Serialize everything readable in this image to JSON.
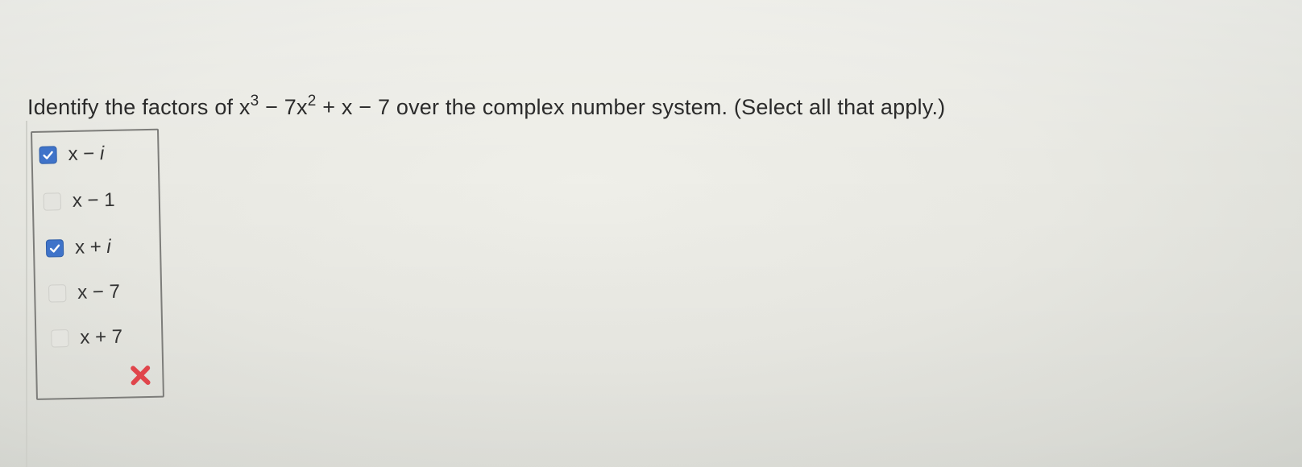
{
  "question": {
    "prefix": "Identify the factors of x",
    "exp1": "3",
    "mid1": " − 7x",
    "exp2": "2",
    "suffix": " + x − 7 over the complex number system. (Select all that apply.)"
  },
  "options": [
    {
      "label_pre": "x − ",
      "label_var": "i",
      "checked": true
    },
    {
      "label_pre": "x − 1",
      "label_var": "",
      "checked": false
    },
    {
      "label_pre": "x + ",
      "label_var": "i",
      "checked": true
    },
    {
      "label_pre": "x − 7",
      "label_var": "",
      "checked": false
    },
    {
      "label_pre": "x + 7",
      "label_var": "",
      "checked": false
    }
  ],
  "result": {
    "icon": "incorrect-x-icon",
    "color": "#e0454b"
  },
  "colors": {
    "checkbox_checked": "#3f73c9",
    "checkbox_unchecked": "#e4e4df",
    "text": "#2b2b2b"
  }
}
